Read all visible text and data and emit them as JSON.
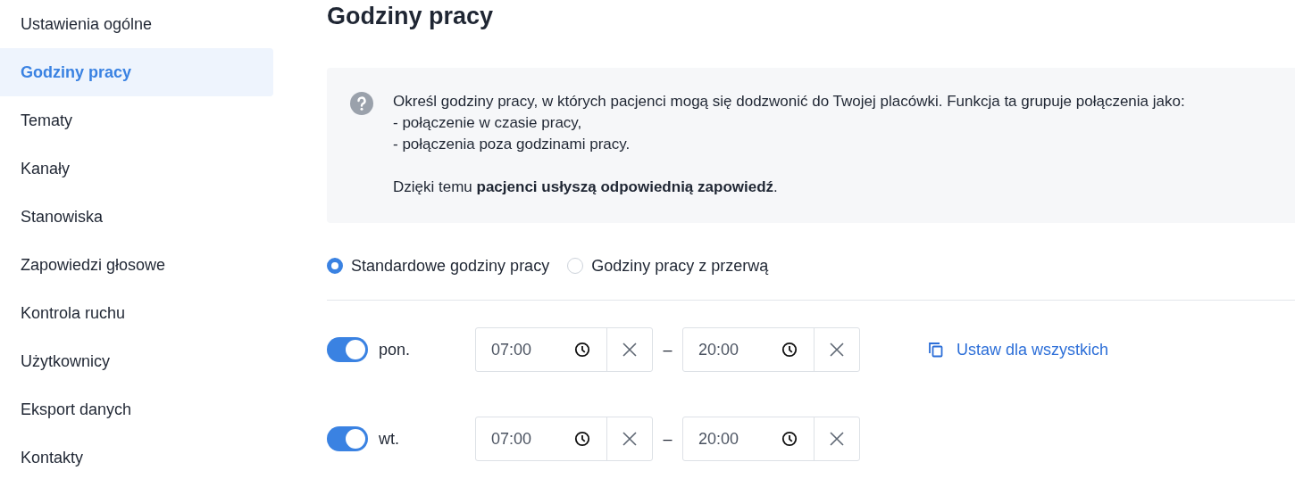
{
  "sidebar": {
    "items": [
      {
        "label": "Ustawienia ogólne",
        "selected": false
      },
      {
        "label": "Godziny pracy",
        "selected": true
      },
      {
        "label": "Tematy",
        "selected": false
      },
      {
        "label": "Kanały",
        "selected": false
      },
      {
        "label": "Stanowiska",
        "selected": false
      },
      {
        "label": "Zapowiedzi głosowe",
        "selected": false
      },
      {
        "label": "Kontrola ruchu",
        "selected": false
      },
      {
        "label": "Użytkownicy",
        "selected": false
      },
      {
        "label": "Eksport danych",
        "selected": false
      },
      {
        "label": "Kontakty",
        "selected": false
      }
    ]
  },
  "title": "Godziny pracy",
  "info": {
    "lines": [
      "Określ godziny pracy, w których pacjenci mogą się dodzwonić do Twojej placówki. Funkcja ta grupuje połączenia jako:",
      "- połączenie w czasie pracy,",
      "- połączenia poza godzinami pracy."
    ],
    "note": "Dzięki temu **pacjenci usłyszą odpowiednią zapowiedź**."
  },
  "modes": [
    {
      "label": "Standardowe godziny pracy",
      "selected": true
    },
    {
      "label": "Godziny pracy z przerwą",
      "selected": false
    }
  ],
  "days": [
    {
      "label": "pon.",
      "on": true,
      "from": "07:00",
      "separator": "–",
      "to": "20:00",
      "action": "Ustaw dla wszystkich"
    },
    {
      "label": "wt.",
      "on": true,
      "from": "07:00",
      "separator": "–",
      "to": "20:00"
    }
  ]
}
